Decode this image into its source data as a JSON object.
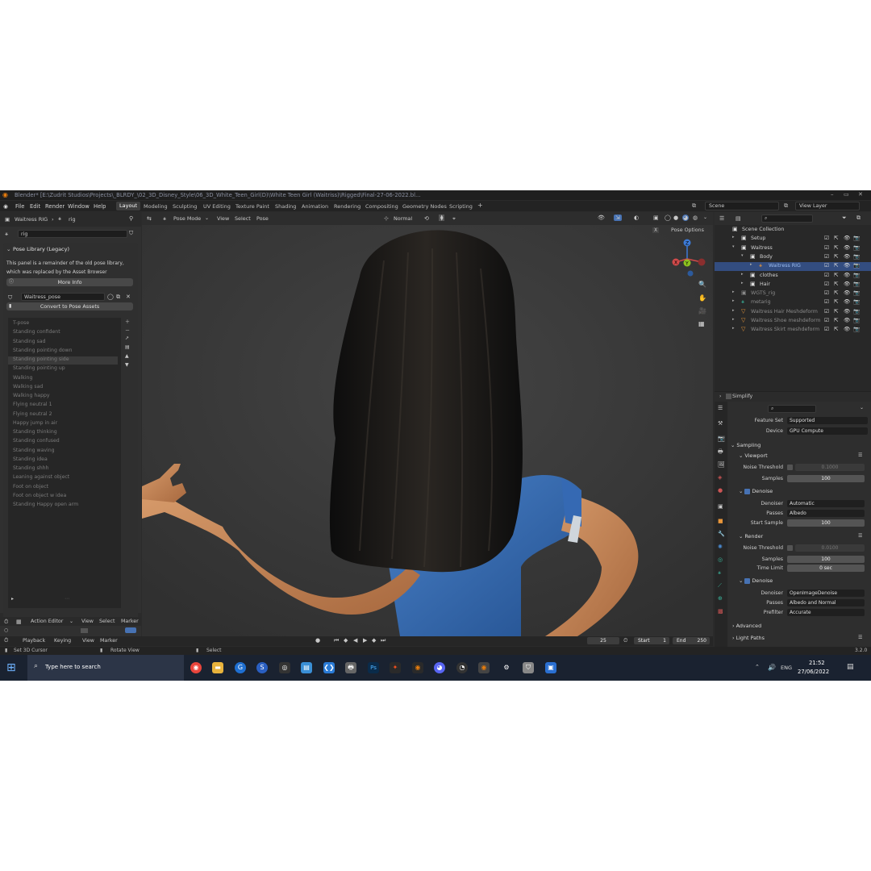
{
  "window": {
    "title": "Blender* [E:\\Zudrit Studios\\Projects\\_BLRDY_\\02_3D_Disney_Style\\06_3D_White_Teen_Girl(D)\\White Teen Girl (Waitriss)\\Rigged\\Final-27-06-2022.bl..."
  },
  "menu": [
    "File",
    "Edit",
    "Render",
    "Window",
    "Help"
  ],
  "workspaces": [
    "Layout",
    "Modeling",
    "Sculpting",
    "UV Editing",
    "Texture Paint",
    "Shading",
    "Animation",
    "Rendering",
    "Compositing",
    "Geometry Nodes",
    "Scripting",
    "+"
  ],
  "scene": {
    "label": "Scene",
    "view_layer": "View Layer"
  },
  "left_panel": {
    "object_name": "Waitress RIG",
    "armature": "rig",
    "search": "rig",
    "panel_title": "Pose Library (Legacy)",
    "note_line1": "This panel is a remainder of the old pose library,",
    "note_line2": "which was replaced by the Asset Browser",
    "more_info": "More Info",
    "library_name": "Waitress_pose",
    "convert_btn": "Convert to Pose Assets",
    "poses": [
      "T-pose",
      "Standing confident",
      "Standing sad",
      "Standing pointing down",
      "Standing pointing side",
      "Standing pointing up",
      "Walking",
      "Walking sad",
      "Walking happy",
      "Flying neutral 1",
      "Flying neutral 2",
      "Happy jump in air",
      "Standing thinking",
      "Standing confused",
      "Standing waving",
      "Standing idea",
      "Standing shhh",
      "Leaning against object",
      "Foot on object",
      "Foot on object w idea",
      "Standing Happy open arm"
    ],
    "selected_pose": "Standing pointing side"
  },
  "action_editor": {
    "mode": "Action Editor",
    "menus": [
      "View",
      "Select",
      "Marker"
    ]
  },
  "viewport": {
    "mode": "Pose Mode",
    "menus": [
      "View",
      "Select",
      "Pose"
    ],
    "orientation": "Normal",
    "pose_options": "Pose Options",
    "axes": {
      "x": "X",
      "y": "Y",
      "z": "Z"
    }
  },
  "outliner": {
    "search": "",
    "items": [
      {
        "label": "Scene Collection",
        "indent": 0
      },
      {
        "label": "Setup",
        "indent": 1
      },
      {
        "label": "Waitress",
        "indent": 1
      },
      {
        "label": "Body",
        "indent": 2
      },
      {
        "label": "Waitress RIG",
        "indent": 3,
        "selected": true
      },
      {
        "label": "clothes",
        "indent": 2
      },
      {
        "label": "Hair",
        "indent": 2
      },
      {
        "label": "WGTS_rig",
        "indent": 1
      },
      {
        "label": "metarig",
        "indent": 1
      },
      {
        "label": "Waitress Hair Meshdeform",
        "indent": 1
      },
      {
        "label": "Waitress Shoe meshdeform",
        "indent": 1
      },
      {
        "label": "Waitress Skirt meshdeform",
        "indent": 1
      }
    ]
  },
  "properties": {
    "simplify": "Simplify",
    "feature_set_label": "Feature Set",
    "feature_set": "Supported",
    "device_label": "Device",
    "device": "GPU Compute",
    "sampling": "Sampling",
    "viewport_section": "Viewport",
    "noise_threshold_label": "Noise Threshold",
    "vp_noise_threshold": "0.1000",
    "samples_label": "Samples",
    "vp_samples": "100",
    "denoise_label": "Denoise",
    "denoiser_label": "Denoiser",
    "vp_denoiser": "Automatic",
    "passes_label": "Passes",
    "vp_passes": "Albedo",
    "start_sample_label": "Start Sample",
    "vp_start_sample": "100",
    "render_section": "Render",
    "r_noise_threshold": "0.0100",
    "r_samples": "100",
    "time_limit_label": "Time Limit",
    "r_time_limit": "0 sec",
    "r_denoiser": "OpenImageDenoise",
    "r_passes": "Albedo and Normal",
    "prefilter_label": "Prefilter",
    "r_prefilter": "Accurate",
    "advanced": "Advanced",
    "light_paths": "Light Paths"
  },
  "timeline": {
    "menus": [
      "Playback",
      "Keying",
      "View",
      "Marker"
    ],
    "current_frame": "25",
    "start_label": "Start",
    "start": "1",
    "end_label": "End",
    "end": "250"
  },
  "statusbar": {
    "left": "Set 3D Cursor",
    "mid": "Rotate View",
    "right": "Select",
    "version": "3.2.0"
  },
  "taskbar": {
    "search_placeholder": "Type here to search",
    "lang": "ENG",
    "time": "21:52",
    "date": "27/06/2022"
  },
  "colors": {
    "accent": "#4772b3",
    "shirt": "#3a6fb8",
    "hair": "#141414",
    "skin": "#c68659"
  }
}
